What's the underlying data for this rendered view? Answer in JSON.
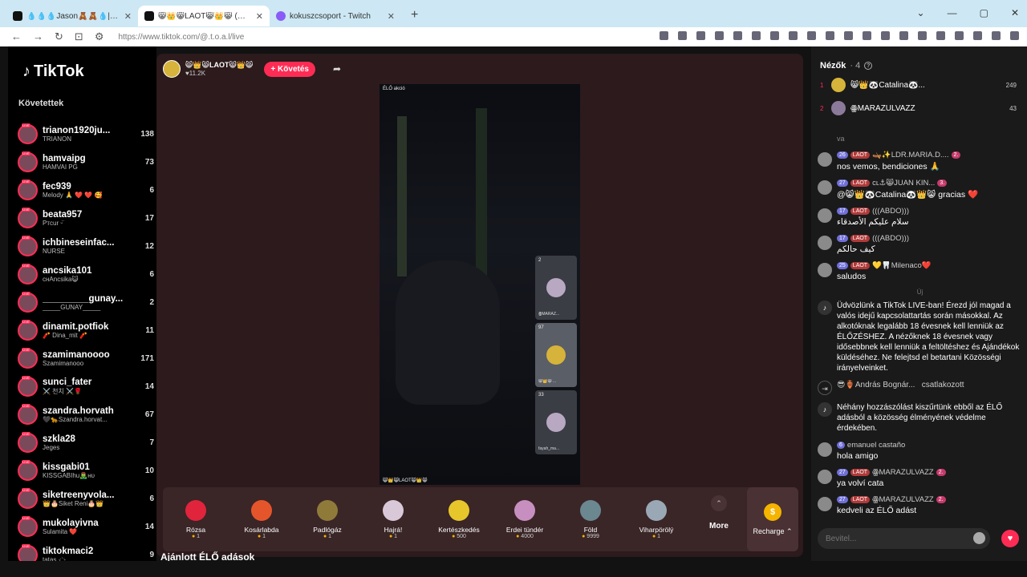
{
  "browser": {
    "tabs": [
      {
        "title": "💧💧💧Jason🧸🧸💧|@jason_san..."
      },
      {
        "title": "😸👑😸LAOT😸👑😸 (@.t..."
      },
      {
        "title": "kokuszcsoport - Twitch"
      }
    ],
    "new_tab": "+",
    "url": "https://www.tiktok.com/@.t.o.a.l/live"
  },
  "sidebar": {
    "logo": "TikTok",
    "section_title": "Követettek",
    "items": [
      {
        "name": "trianon1920ju...",
        "sub": "TRIANON",
        "count": "138"
      },
      {
        "name": "hamvaipg",
        "sub": "HAMVAI PG",
        "count": "73"
      },
      {
        "name": "fec939",
        "sub": "Melody 🙏 ❤️ ❤️ 🥰",
        "count": "6"
      },
      {
        "name": "beata957",
        "sub": "Pᴛcur ᵕ̈",
        "count": "17"
      },
      {
        "name": "ichbineseinfac...",
        "sub": "NURSE",
        "count": "12"
      },
      {
        "name": "ancsika101",
        "sub": "ᴄʜAncsika😺",
        "count": "6"
      },
      {
        "name": "_________gunay...",
        "sub": "_____GUNAY_____",
        "count": "2"
      },
      {
        "name": "dinamit.potfiok",
        "sub": "🧨 Dina_mit 🧨",
        "count": "11"
      },
      {
        "name": "szamimanoooo",
        "sub": "Szamimanooo",
        "count": "171"
      },
      {
        "name": "sunci_fater",
        "sub": "⚔️ 천치 ⚔️🌹",
        "count": "14"
      },
      {
        "name": "szandra.horvath",
        "sub": "🖤🐆Szandra.horvat...",
        "count": "67"
      },
      {
        "name": "szkla28",
        "sub": "Jeges",
        "count": "7"
      },
      {
        "name": "kissgabi01",
        "sub": "KISSGABIhu🧟‍♂️ʜᴜ",
        "count": "10"
      },
      {
        "name": "siketreenyvola...",
        "sub": "👑🎂Siket Reni🎂👑",
        "count": "6"
      },
      {
        "name": "mukolayivna",
        "sub": "Sulamita ❤️",
        "count": "14"
      },
      {
        "name": "tiktokmaci2",
        "sub": "tatas · ҉ ·",
        "count": "9"
      }
    ]
  },
  "host": {
    "name": "😸👑😸LAOT😸👑😸",
    "likes": "♥11.2K",
    "follow_label": "+ Követés"
  },
  "video": {
    "overlay_title": "ÉLŐ akció",
    "overlay_bottom": "😸👑😸LAOT😸👑😸"
  },
  "guests": [
    {
      "count": "2",
      "name": "ꙮMARAZ..."
    },
    {
      "count": "97",
      "name": "😸👑😸 ..."
    },
    {
      "count": "33",
      "name": "fayah_ma..."
    }
  ],
  "gifts": [
    {
      "name": "Rózsa",
      "price": "1",
      "color": "#e0243c"
    },
    {
      "name": "Kosárlabda",
      "price": "1",
      "color": "#e5552b"
    },
    {
      "name": "Padlógáz",
      "price": "1",
      "color": "#8f7a3a"
    },
    {
      "name": "Hajrá!",
      "price": "1",
      "color": "#d9c8d8"
    },
    {
      "name": "Kertészkedés",
      "price": "500",
      "color": "#e6c62b"
    },
    {
      "name": "Erdei tündér",
      "price": "4000",
      "color": "#c78fbf"
    },
    {
      "name": "Föld",
      "price": "9999",
      "color": "#6b8790"
    },
    {
      "name": "Viharpörölý",
      "price": "1",
      "color": "#9aa8b6"
    }
  ],
  "more_label": "More",
  "recharge_label": "Recharge ⌃",
  "recommend_title": "Ajánlott ÉLŐ adások",
  "viewers": {
    "title": "Nézők",
    "count": "· 4",
    "list": [
      {
        "rank": "1",
        "name": "😸👑🐼Catalina🐼...",
        "score": "249"
      },
      {
        "rank": "2",
        "name": "ꙮMARAZULVAZZ",
        "score": "43"
      }
    ]
  },
  "chat": {
    "earlier": "va",
    "messages1": [
      {
        "lvl": "26",
        "team": "LAOT",
        "name": "🛶✨LDR.MARIA.D....",
        "rank": "2.",
        "text": "nos vemos, bendiciones 🙏"
      },
      {
        "lvl": "27",
        "team": "LAOT",
        "name": "cʟ⚓😸JUAN KIN...",
        "rank": "3.",
        "text": "@😸👑🐼Catalina🐼👑😸 gracias ❤️"
      },
      {
        "lvl": "17",
        "team": "LAOT",
        "name": "(((ABDO)))",
        "rank": "",
        "text": "سلام عليكم الأصدقاء"
      },
      {
        "lvl": "17",
        "team": "LAOT",
        "name": "(((ABDO)))",
        "rank": "",
        "text": "كيف حالكم"
      },
      {
        "lvl": "25",
        "team": "LAOT",
        "name": "💛🦷Milenaco❤️",
        "rank": "",
        "text": "saludos"
      }
    ],
    "new_label": "Új",
    "welcome": "Üdvözlünk a TikTok LIVE-ban! Érezd jól magad a valós idejű kapcsolattartás során másokkal. Az alkotóknak legalább 18 évesnek kell lenniük az ÉLŐZÉSHEZ. A nézőknek 18 évesnek vagy idősebbnek kell lenniük a feltöltéshez és Ajándékok küldéséhez. Ne felejtsd el betartani Közösségi irányelveinket.",
    "join_name": "😎🏺András Bognár...",
    "join_text": "csatlakozott",
    "filter_notice": "Néhány hozzászólást kiszűrtünk ebből az ÉLŐ adásból a közösség élményének védelme érdekében.",
    "messages2": [
      {
        "lvl": "6",
        "team": "",
        "name": "emanuel castaño",
        "rank": "",
        "text": "hola amigo"
      },
      {
        "lvl": "27",
        "team": "LAOT",
        "name": "ꙮMARAZULVAZZ",
        "rank": "2.",
        "text": "ya volví cata"
      },
      {
        "lvl": "27",
        "team": "LAOT",
        "name": "ꙮMARAZULVAZZ",
        "rank": "2.",
        "text": "kedveli az ÉLŐ adást"
      }
    ],
    "input_placeholder": "Bevitel..."
  }
}
